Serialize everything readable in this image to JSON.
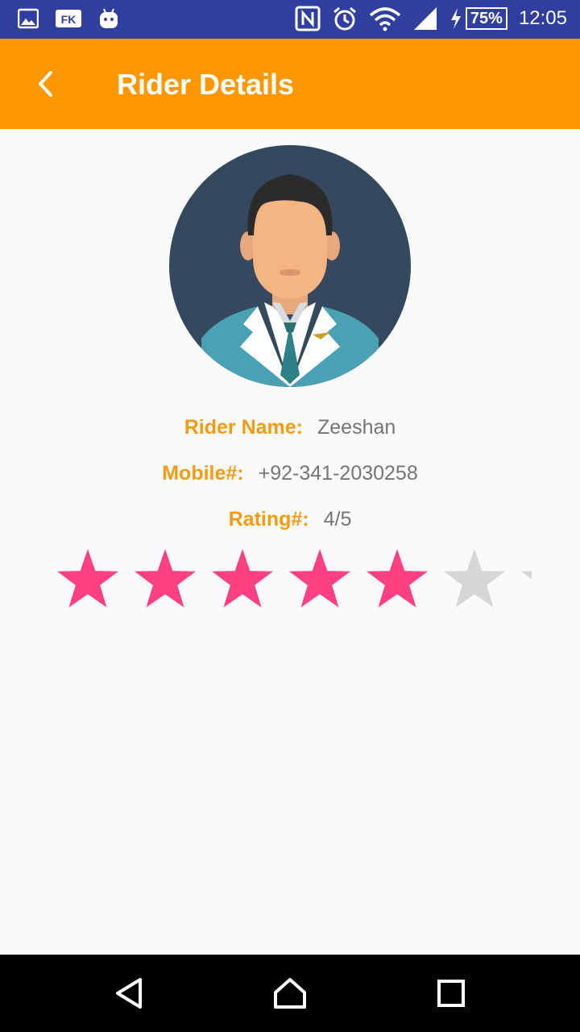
{
  "status_bar": {
    "battery": "75%",
    "time": "12:05",
    "background": "#303F9F",
    "left_icons": [
      "gallery-icon",
      "fk-app-icon",
      "android-debug-icon"
    ],
    "right_icons": [
      "nfc-icon",
      "alarm-icon",
      "wifi-icon",
      "signal-icon",
      "charging-icon"
    ],
    "fk_label": "FK"
  },
  "app_bar": {
    "title": "Rider Details",
    "background": "#FF9800"
  },
  "rider": {
    "name_label": "Rider Name:",
    "name": "Zeeshan",
    "mobile_label": "Mobile#:",
    "mobile": "+92-341-2030258",
    "rating_label": "Rating#:",
    "rating": "4/5"
  },
  "rating_bar": {
    "filled": 5,
    "shown": 7,
    "filled_color": "#FF4081",
    "empty_color": "#D6D6D6"
  },
  "nav_bar": {
    "buttons": [
      "back-icon",
      "home-icon",
      "recents-icon"
    ]
  }
}
